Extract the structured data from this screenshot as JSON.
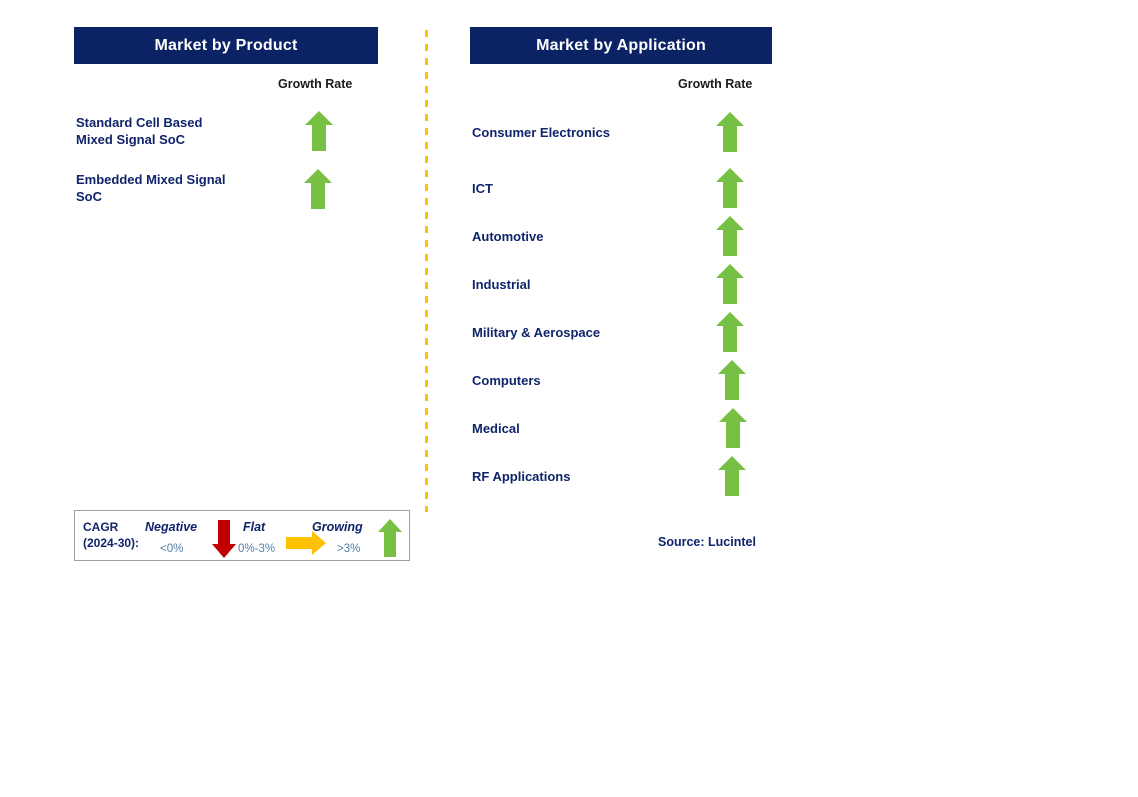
{
  "colors": {
    "header_navy": "#0b2265",
    "label_navy": "#10246b",
    "growth_green": "#77c043",
    "negative_red": "#c00000",
    "flat_orange": "#ffc000",
    "divider_amber": "#fdc200",
    "range_text": "#4f7fa8"
  },
  "panels": [
    {
      "id": "product",
      "title": "Market by Product",
      "column_header": "Growth Rate",
      "rows": [
        {
          "label": "Standard Cell Based\nMixed Signal SoC",
          "icon": "up-arrow-icon",
          "trend": "Growing"
        },
        {
          "label": "Embedded Mixed Signal\nSoC",
          "icon": "up-arrow-icon",
          "trend": "Growing"
        }
      ]
    },
    {
      "id": "application",
      "title": "Market by Application",
      "column_header": "Growth Rate",
      "rows": [
        {
          "label": "Consumer Electronics",
          "icon": "up-arrow-icon",
          "trend": "Growing"
        },
        {
          "label": "ICT",
          "icon": "up-arrow-icon",
          "trend": "Growing"
        },
        {
          "label": "Automotive",
          "icon": "up-arrow-icon",
          "trend": "Growing"
        },
        {
          "label": "Industrial",
          "icon": "up-arrow-icon",
          "trend": "Growing"
        },
        {
          "label": "Military & Aerospace",
          "icon": "up-arrow-icon",
          "trend": "Growing"
        },
        {
          "label": "Computers",
          "icon": "up-arrow-icon",
          "trend": "Growing"
        },
        {
          "label": "Medical",
          "icon": "up-arrow-icon",
          "trend": "Growing"
        },
        {
          "label": "RF Applications",
          "icon": "up-arrow-icon",
          "trend": "Growing"
        }
      ]
    }
  ],
  "legend": {
    "title": "CAGR\n(2024-30):",
    "items": [
      {
        "term": "Negative",
        "range": "<0%",
        "icon": "down-arrow-icon",
        "color": "#c00000"
      },
      {
        "term": "Flat",
        "range": "0%-3%",
        "icon": "right-arrow-icon",
        "color": "#ffc000"
      },
      {
        "term": "Growing",
        "range": ">3%",
        "icon": "up-arrow-icon",
        "color": "#77c043"
      }
    ]
  },
  "source": "Source: Lucintel"
}
